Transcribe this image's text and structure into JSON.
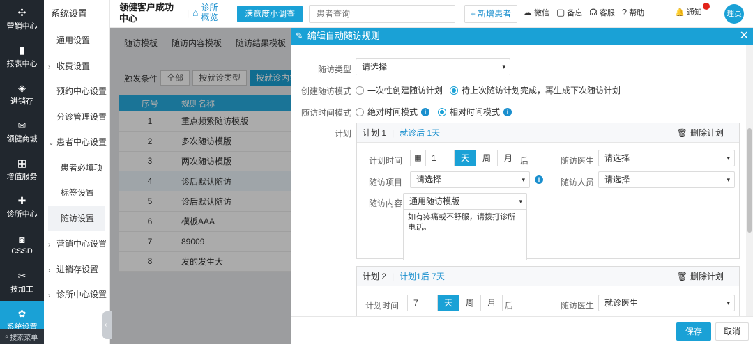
{
  "nav": {
    "items": [
      {
        "icon": "✣",
        "label": "营销中心"
      },
      {
        "icon": "▮",
        "label": "报表中心"
      },
      {
        "icon": "◈",
        "label": "进销存"
      },
      {
        "icon": "✉",
        "label": "领健商城"
      },
      {
        "icon": "▦",
        "label": "增值服务"
      },
      {
        "icon": "✚",
        "label": "诊所中心"
      },
      {
        "icon": "◙",
        "label": "CSSD"
      },
      {
        "icon": "✂",
        "label": "技加工"
      },
      {
        "icon": "✿",
        "label": "系统设置"
      }
    ],
    "search_label": "搜索菜单"
  },
  "subnav": {
    "title": "系统设置",
    "items": [
      {
        "label": "通用设置",
        "kind": "item"
      },
      {
        "label": "收费设置",
        "kind": "group",
        "chev": "›"
      },
      {
        "label": "预约中心设置",
        "kind": "item"
      },
      {
        "label": "分诊管理设置",
        "kind": "item"
      },
      {
        "label": "患者中心设置",
        "kind": "group",
        "chev": "⌄"
      },
      {
        "label": "患者必填项",
        "kind": "child"
      },
      {
        "label": "标签设置",
        "kind": "child"
      },
      {
        "label": "随访设置",
        "kind": "active"
      },
      {
        "label": "营销中心设置",
        "kind": "group",
        "chev": "›"
      },
      {
        "label": "进销存设置",
        "kind": "group",
        "chev": "›"
      },
      {
        "label": "诊所中心设置",
        "kind": "group",
        "chev": "›"
      }
    ]
  },
  "topbar": {
    "brand": "领健客户成功中心",
    "separator": "|",
    "overview": "诊所概览",
    "promo": "满意度小调查",
    "search_placeholder": "患者查询",
    "add_patient": "+ 新增患者",
    "tools": [
      {
        "icon": "☁",
        "label": "微信"
      },
      {
        "icon": "▢",
        "label": "备忘"
      },
      {
        "icon": "☊",
        "label": "客服"
      },
      {
        "icon": "?",
        "label": "帮助"
      }
    ],
    "notify": "通知",
    "avatar": "理员"
  },
  "background": {
    "tabs": [
      "随访模板",
      "随访内容模板",
      "随访结果模板"
    ],
    "cond_label": "触发条件",
    "cond_chips": [
      "全部",
      "按就诊类型",
      "按就诊内容"
    ],
    "table": {
      "headers": [
        "序号",
        "规则名称"
      ],
      "rows": [
        [
          "1",
          "重点频繁随访模版"
        ],
        [
          "2",
          "多次随访模版"
        ],
        [
          "3",
          "两次随访模版"
        ],
        [
          "4",
          "诊后默认随访"
        ],
        [
          "5",
          "诊后默认随访"
        ],
        [
          "6",
          "模板AAA"
        ],
        [
          "7",
          "89009"
        ],
        [
          "8",
          "发的发生大"
        ]
      ]
    }
  },
  "dialog": {
    "title": "编辑自动随访规则",
    "close": "✕",
    "fields": {
      "type_label": "随访类型",
      "type_value": "请选择",
      "create_label": "创建随访模式",
      "create_opt1": "一次性创建随访计划",
      "create_opt2": "待上次随访计划完成，再生成下次随访计划",
      "time_label": "随访时间模式",
      "time_opt1": "绝对时间模式",
      "time_opt2": "相对时间模式",
      "plan_label": "计划"
    },
    "plans": [
      {
        "name": "计划 1",
        "bar": "|",
        "when": "就诊后 1天",
        "delete": "删除计划",
        "time_label": "计划时间",
        "num": "1",
        "units": [
          "天",
          "周",
          "月"
        ],
        "after": "后",
        "doctor_label": "随访医生",
        "doctor_value": "请选择",
        "item_label": "随访项目",
        "item_value": "请选择",
        "person_label": "随访人员",
        "person_value": "请选择",
        "content_label": "随访内容",
        "content_value": "通用随访模版",
        "content_text": "如有疼痛或不舒服，请拨打诊所电话。"
      },
      {
        "name": "计划 2",
        "bar": "|",
        "when": "计划1后 7天",
        "delete": "删除计划",
        "time_label": "计划时间",
        "num": "7",
        "units": [
          "天",
          "周",
          "月"
        ],
        "after": "后",
        "doctor_label": "随访医生",
        "doctor_value": "就诊医生"
      }
    ],
    "save": "保存",
    "cancel": "取消"
  },
  "icons": {
    "edit": "✎",
    "home": "⌂",
    "calendar": "▦",
    "trash": "🗑",
    "info": "i",
    "arrow": "▾",
    "bell": "🔔",
    "search": "⌕",
    "handle": "‹"
  },
  "colors": {
    "accent": "#1aa1d6",
    "nav_bg": "#21272e",
    "badge": "#e2231a"
  }
}
